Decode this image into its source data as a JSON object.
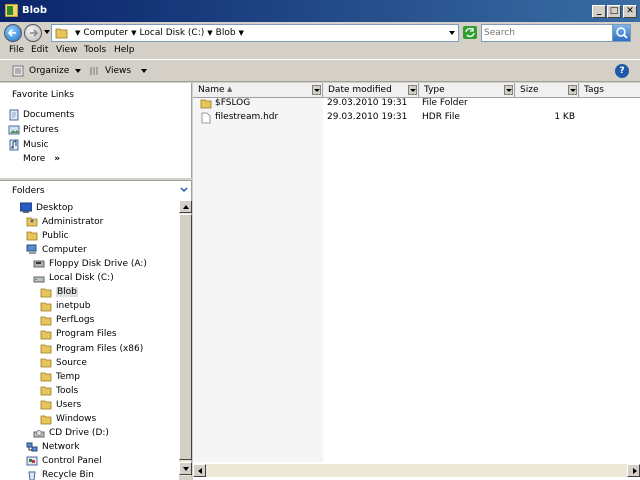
{
  "window": {
    "title": "Blob"
  },
  "address": {
    "crumbs": [
      "Computer",
      "Local Disk (C:)",
      "Blob"
    ],
    "search_placeholder": "Search"
  },
  "menu": {
    "items": [
      "File",
      "Edit",
      "View",
      "Tools",
      "Help"
    ]
  },
  "toolbar": {
    "organize": "Organize",
    "views": "Views",
    "help": "?"
  },
  "favorites": {
    "title": "Favorite Links",
    "items": [
      "Documents",
      "Pictures",
      "Music"
    ],
    "more": "More",
    "more_arrow": "»"
  },
  "folders": {
    "title": "Folders",
    "tree": [
      {
        "label": "Desktop",
        "icon": "desktop-icon"
      },
      {
        "label": "Administrator",
        "icon": "user-folder-icon"
      },
      {
        "label": "Public",
        "icon": "folder-icon"
      },
      {
        "label": "Computer",
        "icon": "computer-icon"
      },
      {
        "label": "Floppy Disk Drive (A:)",
        "icon": "floppy-icon"
      },
      {
        "label": "Local Disk (C:)",
        "icon": "disk-icon"
      },
      {
        "label": "Blob",
        "icon": "folder-icon",
        "selected": true
      },
      {
        "label": "inetpub",
        "icon": "folder-icon"
      },
      {
        "label": "PerfLogs",
        "icon": "folder-icon"
      },
      {
        "label": "Program Files",
        "icon": "folder-icon"
      },
      {
        "label": "Program Files (x86)",
        "icon": "folder-icon"
      },
      {
        "label": "Source",
        "icon": "folder-icon"
      },
      {
        "label": "Temp",
        "icon": "folder-icon"
      },
      {
        "label": "Tools",
        "icon": "folder-icon"
      },
      {
        "label": "Users",
        "icon": "folder-icon"
      },
      {
        "label": "Windows",
        "icon": "folder-icon"
      },
      {
        "label": "CD Drive (D:)",
        "icon": "cd-icon"
      },
      {
        "label": "Network",
        "icon": "network-icon"
      },
      {
        "label": "Control Panel",
        "icon": "control-panel-icon"
      },
      {
        "label": "Recycle Bin",
        "icon": "recycle-bin-icon"
      }
    ]
  },
  "columns": {
    "name": "Name",
    "date": "Date modified",
    "type": "Type",
    "size": "Size",
    "tags": "Tags"
  },
  "files": [
    {
      "name": "$FSLOG",
      "date": "29.03.2010 19:31",
      "type": "File Folder",
      "size": "",
      "icon": "folder-icon"
    },
    {
      "name": "filestream.hdr",
      "date": "29.03.2010 19:31",
      "type": "HDR File",
      "size": "1 KB",
      "icon": "file-icon"
    }
  ],
  "colors": {
    "title_bar": "#0a246a",
    "folder": "#e8c55a",
    "window_bg": "#d4d0c8"
  }
}
